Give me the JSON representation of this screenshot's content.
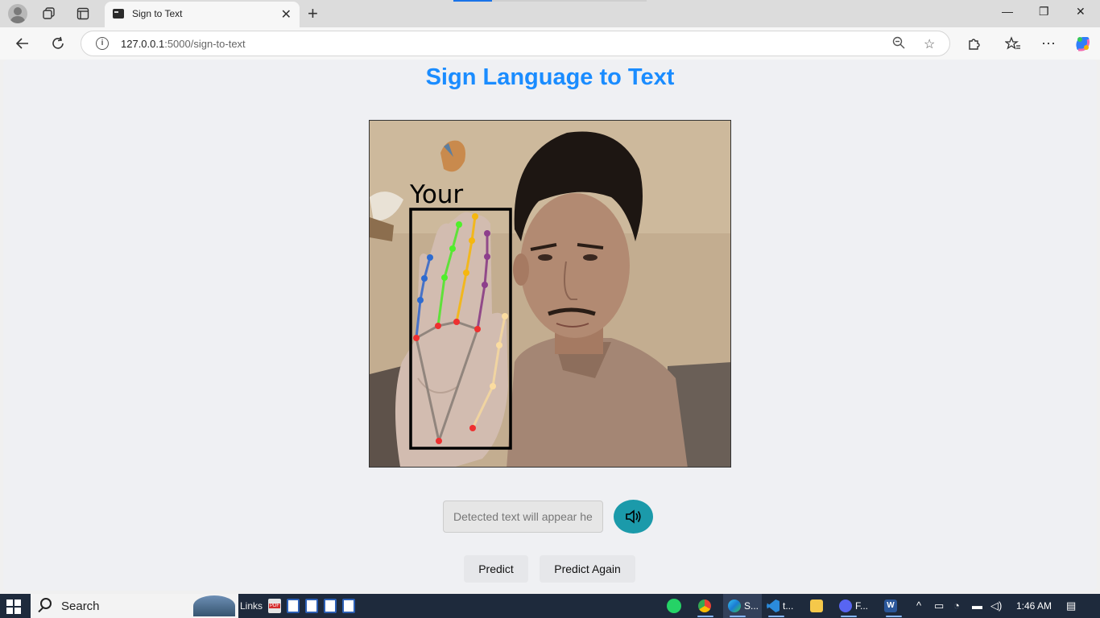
{
  "browser": {
    "tab_title": "Sign to Text",
    "url_host": "127.0.0.1",
    "url_path": ":5000/sign-to-text"
  },
  "page": {
    "title": "Sign Language to Text",
    "camera_overlay_text": "Your",
    "detected_placeholder": "Detected text will appear here",
    "predict_label": "Predict",
    "predict_again_label": "Predict Again"
  },
  "taskbar": {
    "search_label": "Search",
    "links_label": "Links",
    "apps": [
      {
        "label": "S...",
        "icon": "edge-icon"
      },
      {
        "label": "t...",
        "icon": "vscode-icon"
      },
      {
        "label": "F...",
        "icon": "discord-icon"
      }
    ],
    "time": "1:46 AM"
  },
  "colors": {
    "title_blue": "#1a8cff",
    "speaker_teal": "#1b9aaa"
  }
}
